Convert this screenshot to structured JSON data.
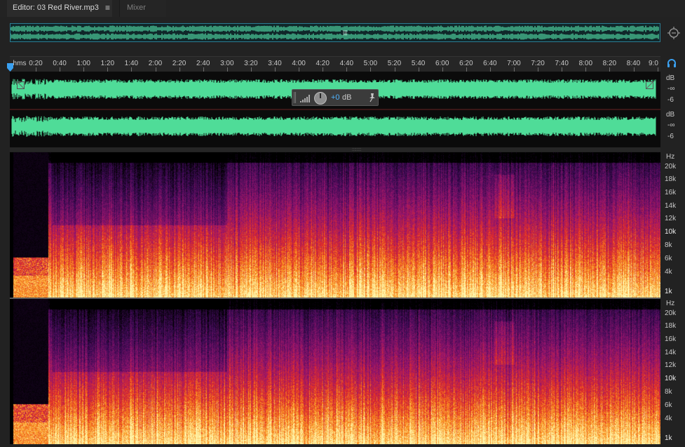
{
  "tabs": {
    "editor_label": "Editor: 03 Red River.mp3",
    "menu_glyph": "≡",
    "mixer_label": "Mixer"
  },
  "overview": {
    "handle_glyph": "|||"
  },
  "icons": {
    "zoom": "zoom-icon",
    "headphones": "headphones-icon",
    "playhead": "playhead-icon",
    "pin": "pin-icon",
    "resize": "resize-icon"
  },
  "ruler": {
    "unit_label": "hms",
    "labels": [
      "0:20",
      "0:40",
      "1:00",
      "1:20",
      "1:40",
      "2:00",
      "2:20",
      "2:40",
      "3:00",
      "3:20",
      "3:40",
      "4:00",
      "4:20",
      "4:40",
      "5:00",
      "5:20",
      "5:40",
      "6:00",
      "6:20",
      "6:40",
      "7:00",
      "7:20",
      "7:40",
      "8:00",
      "8:20",
      "8:40",
      "9:0"
    ]
  },
  "amplitude_scale": {
    "channel_1": {
      "unit": "dB",
      "labels": [
        "-∞",
        "-6"
      ]
    },
    "channel_2": {
      "unit": "dB",
      "labels": [
        "-∞",
        "-6"
      ]
    }
  },
  "hud": {
    "value": "+0",
    "unit": "dB"
  },
  "frequency_scale": {
    "unit": "Hz",
    "labels": [
      "20k",
      "18k",
      "16k",
      "14k",
      "12k",
      "10k",
      "8k",
      "6k",
      "4k",
      "1k"
    ]
  },
  "colors": {
    "waveform": "#4fdc98",
    "overview_wave": "#4ed3a0",
    "overview_border": "#2a7d93",
    "accent_blue": "#4fb4ff",
    "spectrogram_low": "#fff2a0",
    "spectrogram_mid": "#f0401c",
    "spectrogram_high": "#54187a"
  }
}
